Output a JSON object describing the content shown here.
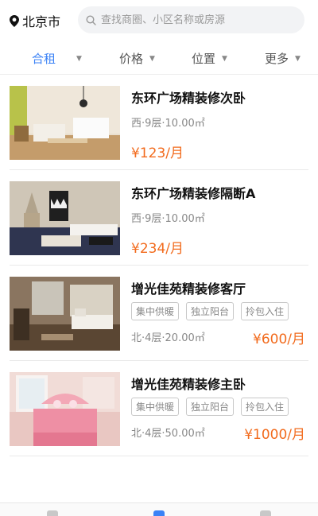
{
  "header": {
    "city": "北京市",
    "search_placeholder": "查找商圈、小区名称或房源",
    "search_value": ""
  },
  "filters": [
    {
      "label": "合租",
      "active": true
    },
    {
      "label": "价格",
      "active": false
    },
    {
      "label": "位置",
      "active": false
    },
    {
      "label": "更多",
      "active": false
    }
  ],
  "listings": [
    {
      "title": "东环广场精装修次卧",
      "meta": "西·9层·10.00㎡",
      "price": "¥123/月",
      "tags": []
    },
    {
      "title": "东环广场精装修隔断A",
      "meta": "西·9层·10.00㎡",
      "price": "¥234/月",
      "tags": []
    },
    {
      "title": "增光佳苑精装修客厅",
      "meta": "北·4层·20.00㎡",
      "price": "¥600/月",
      "tags": [
        "集中供暖",
        "独立阳台",
        "拎包入住"
      ]
    },
    {
      "title": "增光佳苑精装修主卧",
      "meta": "北·4层·50.00㎡",
      "price": "¥1000/月",
      "tags": [
        "集中供暖",
        "独立阳台",
        "拎包入住"
      ]
    }
  ],
  "bottom_nav": {
    "active_index": 1,
    "count": 3
  },
  "colors": {
    "accent": "#3b82f6",
    "price": "#f26b1d"
  }
}
